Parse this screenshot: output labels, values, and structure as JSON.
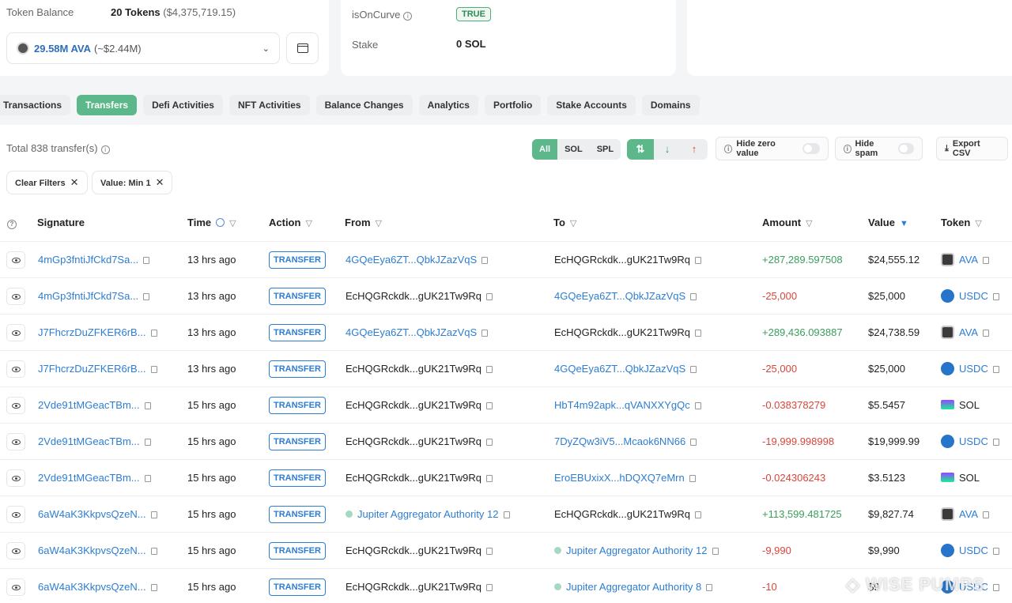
{
  "summary": {
    "token_balance_label": "Token Balance",
    "token_balance_value": "20 Tokens",
    "token_balance_usd": "($4,375,719.15)",
    "selected_token_amount": "29.58M AVA",
    "selected_token_usd": "(~$2.44M)",
    "is_on_curve_label": "isOnCurve",
    "is_on_curve_value": "TRUE",
    "stake_label": "Stake",
    "stake_value": "0 SOL"
  },
  "tabs": [
    "Transactions",
    "Transfers",
    "Defi Activities",
    "NFT Activities",
    "Balance Changes",
    "Analytics",
    "Portfolio",
    "Stake Accounts",
    "Domains"
  ],
  "active_tab": "Transfers",
  "toolbar": {
    "total_text": "Total 838 transfer(s)",
    "type_filters": [
      "All",
      "SOL",
      "SPL"
    ],
    "direction_icons": [
      "both-arrows-icon",
      "arrow-down-icon",
      "arrow-up-icon"
    ],
    "hide_zero_label": "Hide zero value",
    "hide_spam_label": "Hide spam",
    "export_label": "Export CSV"
  },
  "filters": {
    "clear_label": "Clear Filters",
    "value_min_label": "Value: Min 1"
  },
  "table": {
    "columns": [
      "Signature",
      "Time",
      "Action",
      "From",
      "To",
      "Amount",
      "Value",
      "Token"
    ],
    "rows": [
      {
        "signature": "4mGp3fntiJfCkd7Sa...",
        "time": "13 hrs ago",
        "action": "TRANSFER",
        "from": "4GQeEya6ZT...QbkJZazVqS",
        "to": "EcHQGRckdk...gUK21Tw9Rq",
        "amount": "+287,289.597508",
        "value": "$24,555.12",
        "token": "AVA"
      },
      {
        "signature": "4mGp3fntiJfCkd7Sa...",
        "time": "13 hrs ago",
        "action": "TRANSFER",
        "from": "EcHQGRckdk...gUK21Tw9Rq",
        "to": "4GQeEya6ZT...QbkJZazVqS",
        "amount": "-25,000",
        "value": "$25,000",
        "token": "USDC"
      },
      {
        "signature": "J7FhcrzDuZFKER6rB...",
        "time": "13 hrs ago",
        "action": "TRANSFER",
        "from": "4GQeEya6ZT...QbkJZazVqS",
        "to": "EcHQGRckdk...gUK21Tw9Rq",
        "amount": "+289,436.093887",
        "value": "$24,738.59",
        "token": "AVA"
      },
      {
        "signature": "J7FhcrzDuZFKER6rB...",
        "time": "13 hrs ago",
        "action": "TRANSFER",
        "from": "EcHQGRckdk...gUK21Tw9Rq",
        "to": "4GQeEya6ZT...QbkJZazVqS",
        "amount": "-25,000",
        "value": "$25,000",
        "token": "USDC"
      },
      {
        "signature": "2Vde91tMGeacTBm...",
        "time": "15 hrs ago",
        "action": "TRANSFER",
        "from": "EcHQGRckdk...gUK21Tw9Rq",
        "to": "HbT4m92apk...qVANXXYgQc",
        "amount": "-0.038378279",
        "value": "$5.5457",
        "token": "SOL"
      },
      {
        "signature": "2Vde91tMGeacTBm...",
        "time": "15 hrs ago",
        "action": "TRANSFER",
        "from": "EcHQGRckdk...gUK21Tw9Rq",
        "to": "7DyZQw3iV5...Mcaok6NN66",
        "amount": "-19,999.998998",
        "value": "$19,999.99",
        "token": "USDC"
      },
      {
        "signature": "2Vde91tMGeacTBm...",
        "time": "15 hrs ago",
        "action": "TRANSFER",
        "from": "EcHQGRckdk...gUK21Tw9Rq",
        "to": "EroEBUxixX...hDQXQ7eMrn",
        "amount": "-0.024306243",
        "value": "$3.5123",
        "token": "SOL"
      },
      {
        "signature": "6aW4aK3KkpvsQzeN...",
        "time": "15 hrs ago",
        "action": "TRANSFER",
        "from": "Jupiter Aggregator Authority 12",
        "to": "EcHQGRckdk...gUK21Tw9Rq",
        "amount": "+113,599.481725",
        "value": "$9,827.74",
        "token": "AVA"
      },
      {
        "signature": "6aW4aK3KkpvsQzeN...",
        "time": "15 hrs ago",
        "action": "TRANSFER",
        "from": "EcHQGRckdk...gUK21Tw9Rq",
        "to": "Jupiter Aggregator Authority 12",
        "amount": "-9,990",
        "value": "$9,990",
        "token": "USDC"
      },
      {
        "signature": "6aW4aK3KkpvsQzeN...",
        "time": "15 hrs ago",
        "action": "TRANSFER",
        "from": "EcHQGRckdk...gUK21Tw9Rq",
        "to": "Jupiter Aggregator Authority 8",
        "amount": "-10",
        "value": "$9",
        "token": "USDC"
      }
    ]
  },
  "watermark": "WISE PUMPS",
  "colors": {
    "accent": "#5cb88a",
    "link": "#2d7dd2",
    "positive": "#3a9e5c",
    "negative": "#d9453a"
  }
}
